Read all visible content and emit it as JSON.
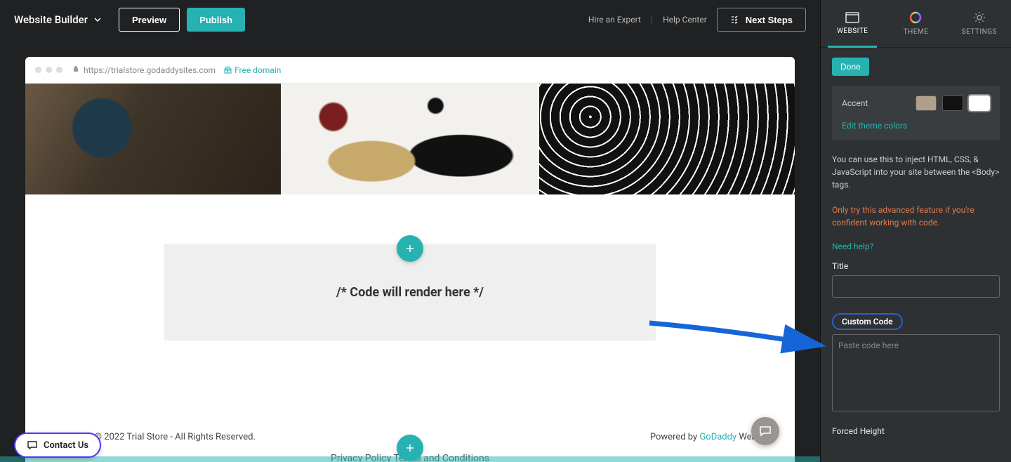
{
  "topbar": {
    "brand": "Website Builder",
    "preview": "Preview",
    "publish": "Publish",
    "hire": "Hire an Expert",
    "help": "Help Center",
    "next": "Next Steps"
  },
  "browser": {
    "url": "https://trialstore.godaddysites.com",
    "free_domain": "Free domain"
  },
  "canvas": {
    "code_placeholder": "/* Code will render here */",
    "copyright": "Copyright © 2022 Trial Store - All Rights Reserved.",
    "powered_prefix": "Powered by ",
    "powered_link": "GoDaddy",
    "powered_suffix": " Websit",
    "legal": "Privacy Policy   Terms and Conditions"
  },
  "sidebar": {
    "tabs": {
      "website": "WEBSITE",
      "theme": "THEME",
      "settings": "SETTINGS"
    },
    "done": "Done",
    "accent_label": "Accent",
    "swatches": {
      "tan": "#b19f8c",
      "black": "#111111",
      "white": "#ffffff"
    },
    "edit_colors": "Edit theme colors",
    "inject_help": "You can use this to inject HTML, CSS, & JavaScript into your site between the <Body> tags.",
    "warn": "Only try this advanced feature if you're confident working with code.",
    "need_help": "Need help?",
    "title_label": "Title",
    "custom_code_label": "Custom Code",
    "code_placeholder": "Paste code here",
    "forced_height": "Forced Height"
  },
  "contact": "Contact Us"
}
